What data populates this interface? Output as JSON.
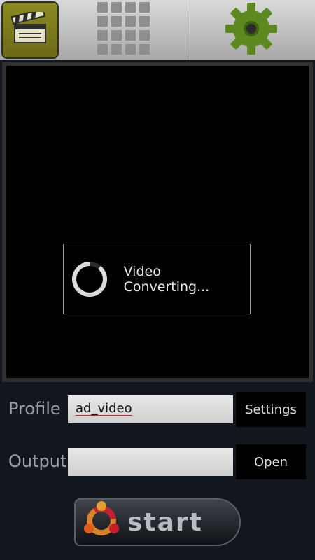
{
  "toolbar": {
    "items": [
      {
        "icon": "clapperboard-icon",
        "active": true
      },
      {
        "icon": "grid-icon",
        "active": false
      },
      {
        "icon": "gear-icon",
        "active": false
      }
    ]
  },
  "dialog": {
    "message": "Video Converting..."
  },
  "profile": {
    "label": "Profile",
    "value": "ad_video",
    "button": "Settings"
  },
  "output": {
    "label": "Output",
    "value": "",
    "button": "Open"
  },
  "start": {
    "label": "start"
  },
  "colors": {
    "background": "#12161d",
    "active_toolbar": "#7c7a1c",
    "gear": "#5d8a1f"
  }
}
